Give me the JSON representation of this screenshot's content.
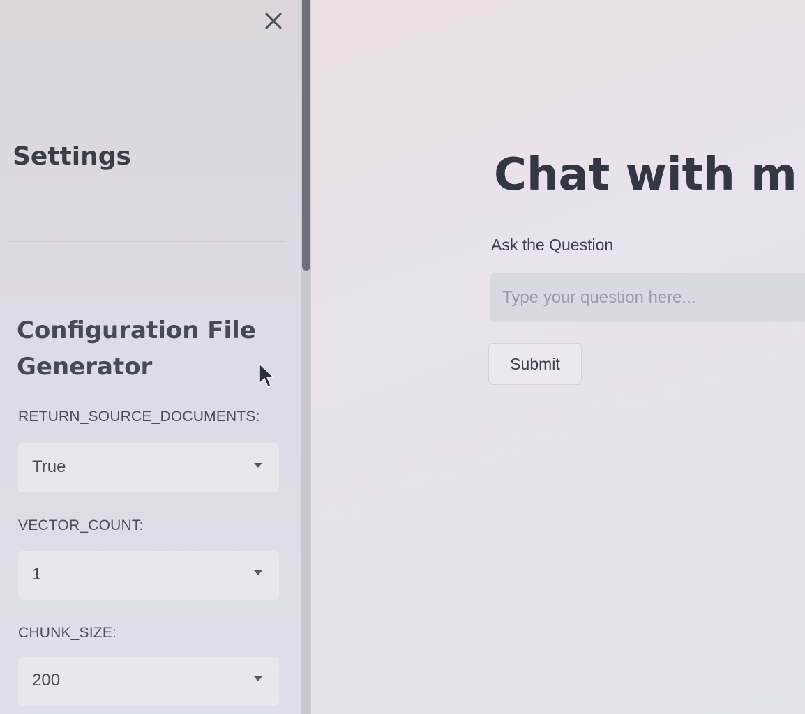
{
  "sidebar": {
    "close_icon": "close-icon",
    "heading": "Settings",
    "config_title": "Configuration File Generator",
    "fields": [
      {
        "label": "RETURN_SOURCE_DOCUMENTS:",
        "value": "True"
      },
      {
        "label": "VECTOR_COUNT:",
        "value": "1"
      },
      {
        "label": "CHUNK_SIZE:",
        "value": "200"
      }
    ]
  },
  "main": {
    "title": "Chat with m",
    "question_label": "Ask the Question",
    "question_placeholder": "Type your question here...",
    "question_value": "",
    "submit_label": "Submit"
  },
  "colors": {
    "sidebar_bg": "#dddbe5",
    "main_bg": "#e8e3ec",
    "input_bg": "#d9d9e2",
    "text": "#363845"
  }
}
